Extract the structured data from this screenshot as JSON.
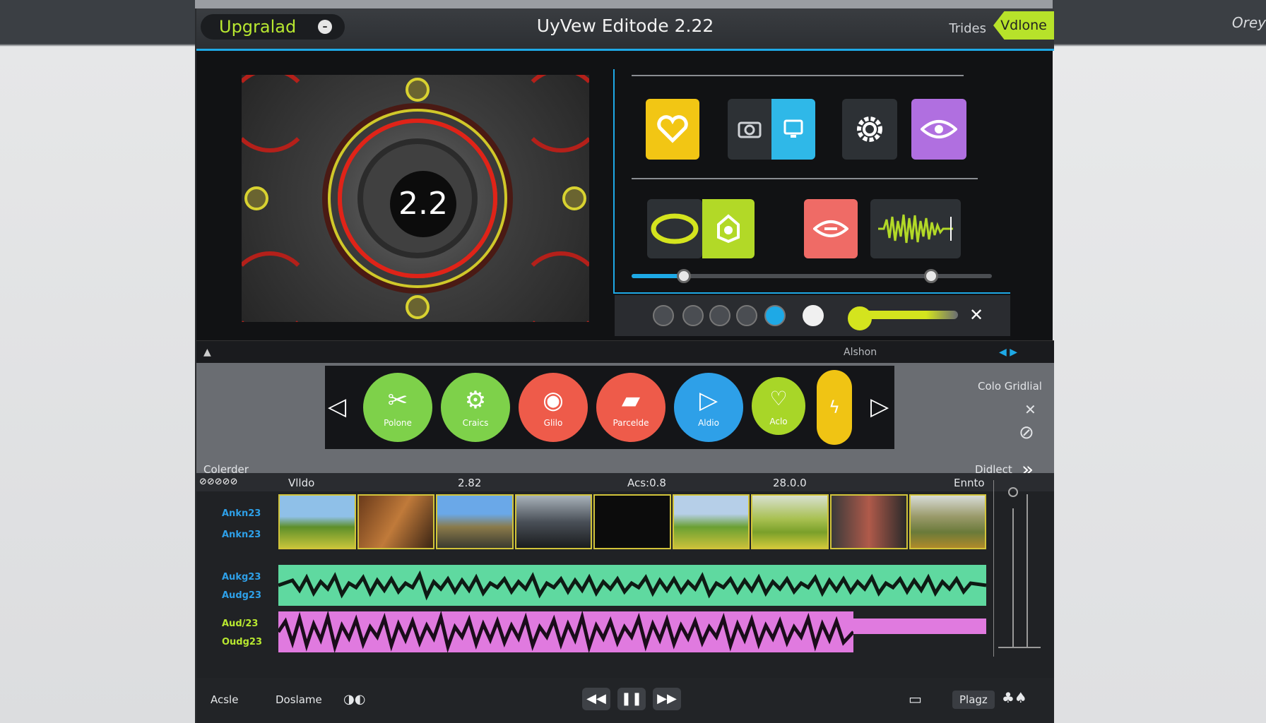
{
  "app": {
    "title": "UyVew Editode 2.22",
    "badge": "Upgralad",
    "tabs": [
      "Trides",
      "Vdlone"
    ],
    "right_label": "Orey"
  },
  "preview": {
    "version": "2.2"
  },
  "panel_tiles": [
    {
      "icon": "heart-icon",
      "color": "#f2c614"
    },
    {
      "icon": "camera-icon",
      "color": "#2d3135"
    },
    {
      "icon": "monitor-icon",
      "color": "#2fb8e8"
    },
    {
      "icon": "gear-icon",
      "color": "#2d3135"
    },
    {
      "icon": "eye-icon",
      "color": "#b06fe0"
    },
    {
      "icon": "eye-outline-icon",
      "color": "#2d3135"
    },
    {
      "icon": "bug-icon",
      "color": "#b2d927"
    },
    {
      "icon": "eye-red-icon",
      "color": "#ef6b66"
    },
    {
      "icon": "waveform-icon",
      "color": "#2d3135"
    }
  ],
  "midbar": {
    "label": "Alshon"
  },
  "tools": [
    {
      "label": "Polone",
      "icon": "tools-icon",
      "color": "#7ed14a"
    },
    {
      "label": "Craics",
      "icon": "gear-icon",
      "color": "#7ed14a"
    },
    {
      "label": "Glilo",
      "icon": "eye-icon",
      "color": "#ee5b4a"
    },
    {
      "label": "Parcelde",
      "icon": "bucket-icon",
      "color": "#ee5b4a"
    },
    {
      "label": "Aldio",
      "icon": "play-icon",
      "color": "#2ea0e8"
    },
    {
      "label": "Aclo",
      "icon": "shield-icon",
      "color": "#a8d628"
    },
    {
      "label": "",
      "icon": "spark-icon",
      "color": "#f0c414"
    }
  ],
  "toolzone": {
    "color_label": "Colo Gridlial",
    "left_label": "Colerder",
    "right_label": "Didlect"
  },
  "timeline": {
    "head_labels": [
      "Vlldo",
      "2.82",
      "Acs:0.8",
      "28.0.0",
      "Ennto"
    ],
    "video_tracks": [
      "Ankn23",
      "Ankn23"
    ],
    "audio_a_tracks": [
      "Aukg23",
      "Audg23"
    ],
    "audio_b_tracks": [
      "Aud/23",
      "Oudg23"
    ]
  },
  "bottombar": {
    "left": "Acsle",
    "middle": "Doslame",
    "right": "Plagz"
  }
}
